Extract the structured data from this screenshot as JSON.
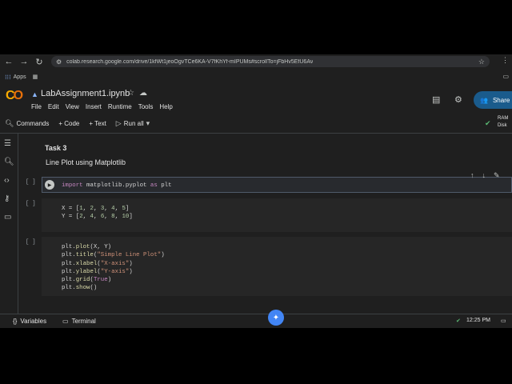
{
  "browser": {
    "url": "colab.research.google.com/drive/1kfWt1jeoOgvTCe6KA-V7fKhYf-mIPUMs#scrollTo=jFbHv5EfU6Av",
    "apps_label": "Apps"
  },
  "colab": {
    "logo": "CO",
    "notebook_title": "LabAssignment1.ipynb",
    "menu": [
      "File",
      "Edit",
      "View",
      "Insert",
      "Runtime",
      "Tools",
      "Help"
    ],
    "share_label": "Share"
  },
  "toolbar": {
    "commands": "Commands",
    "code": "+ Code",
    "text": "+ Text",
    "run_all": "Run all",
    "ram": "RAM",
    "disk": "Disk"
  },
  "text_cell": {
    "title": "Task 3",
    "body": "Line Plot using Matplotlib"
  },
  "cells": [
    {
      "count": "[ ]",
      "lines": [
        "import matplotlib.pyplot as plt"
      ]
    },
    {
      "count": "[ ]",
      "lines": [
        "X = [1, 2, 3, 4, 5]",
        "Y = [2, 4, 6, 8, 10]"
      ]
    },
    {
      "count": "[ ]",
      "lines": [
        "plt.plot(X, Y)",
        "plt.title(\"Simple Line Plot\")",
        "plt.xlabel(\"X-axis\")",
        "plt.ylabel(\"Y-axis\")",
        "plt.grid(True)",
        "plt.show()"
      ]
    }
  ],
  "statusbar": {
    "variables": "Variables",
    "terminal": "Terminal",
    "time": "12:25 PM"
  }
}
